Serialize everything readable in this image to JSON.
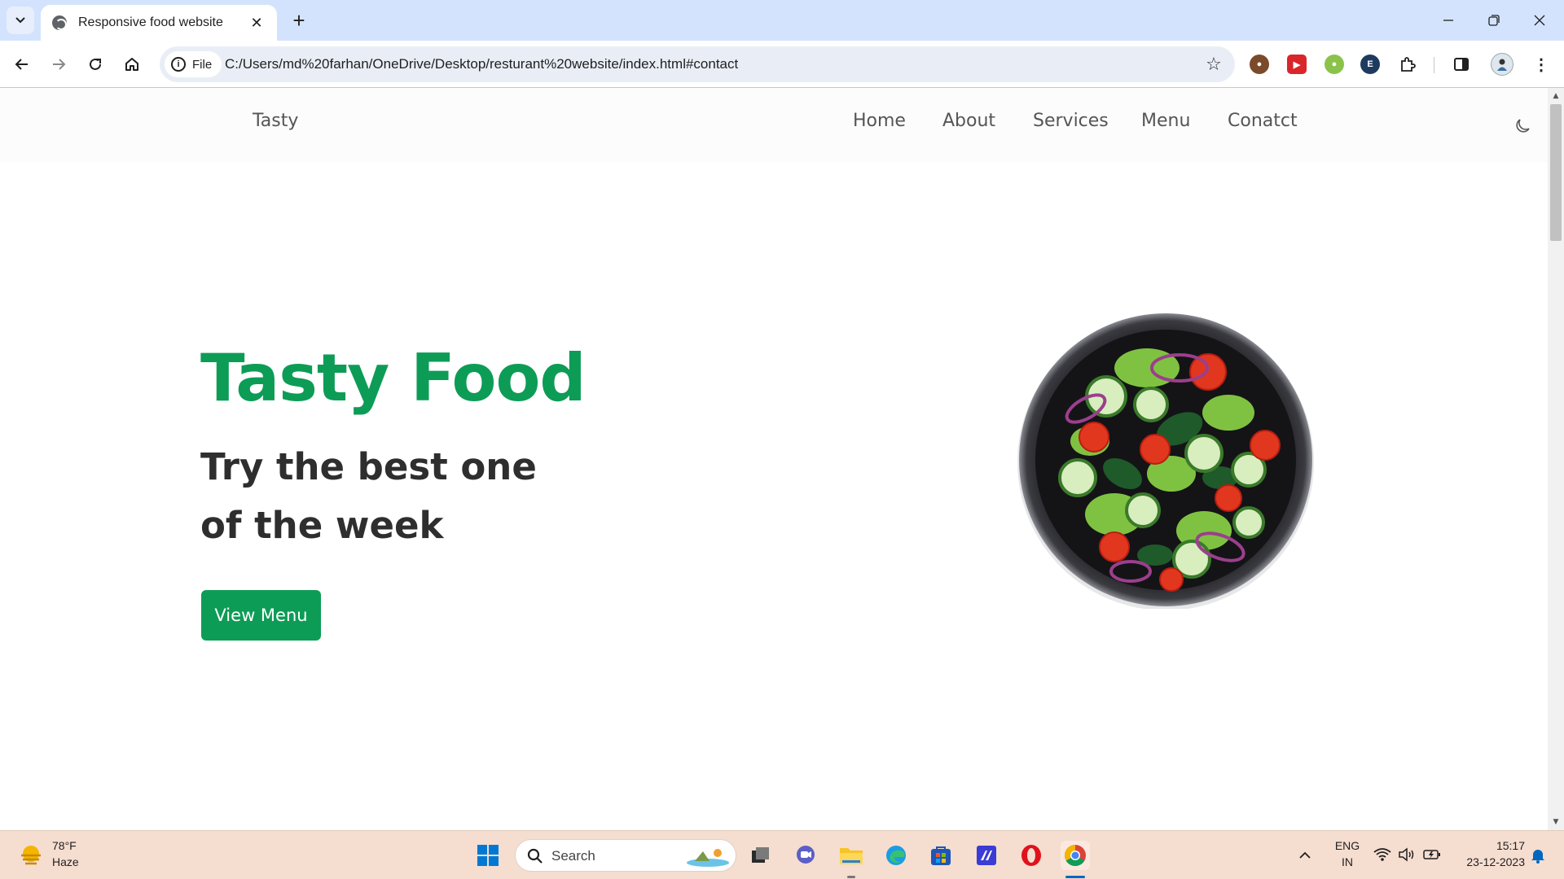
{
  "browser": {
    "tab_title": "Responsive food website",
    "url_chip": "File",
    "url": "C:/Users/md%20farhan/OneDrive/Desktop/resturant%20website/index.html#contact",
    "extension_letter": "E"
  },
  "site": {
    "logo": "Tasty",
    "nav": [
      "Home",
      "About",
      "Services",
      "Menu",
      "Conatct"
    ],
    "hero": {
      "title": "Tasty Food",
      "subtitle": "Try the best one of the week",
      "button": "View Menu"
    }
  },
  "taskbar": {
    "weather_temp": "78°F",
    "weather_condition": "Haze",
    "search_label": "Search",
    "lang_top": "ENG",
    "lang_bottom": "IN",
    "time": "15:17",
    "date": "23-12-2023"
  },
  "colors": {
    "accent_green": "#0d9c56",
    "tabstrip": "#d3e3fd",
    "taskbar": "#f5ddd0"
  }
}
